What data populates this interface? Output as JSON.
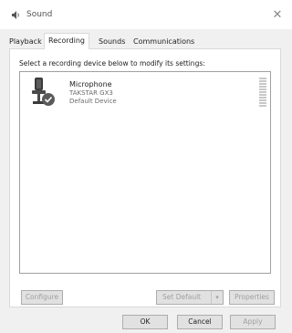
{
  "window": {
    "title": "Sound",
    "close_icon": "close-icon"
  },
  "tabs": [
    {
      "label": "Playback",
      "active": false
    },
    {
      "label": "Recording",
      "active": true
    },
    {
      "label": "Sounds",
      "active": false
    },
    {
      "label": "Communications",
      "active": false
    }
  ],
  "panel": {
    "instructions": "Select a recording device below to modify its settings:",
    "devices": [
      {
        "name": "Microphone",
        "model": "TAKSTAR GX3",
        "status": "Default Device",
        "icon": "microphone-icon",
        "badge": "default-check-icon"
      }
    ],
    "configure_label": "Configure",
    "set_default_label": "Set Default",
    "set_default_arrow": "▾",
    "properties_label": "Properties"
  },
  "footer": {
    "ok_label": "OK",
    "cancel_label": "Cancel",
    "apply_label": "Apply"
  },
  "colors": {
    "window_bg": "#f0f0f0",
    "panel_bg": "#ffffff",
    "check_badge": "#5a5a5a"
  }
}
